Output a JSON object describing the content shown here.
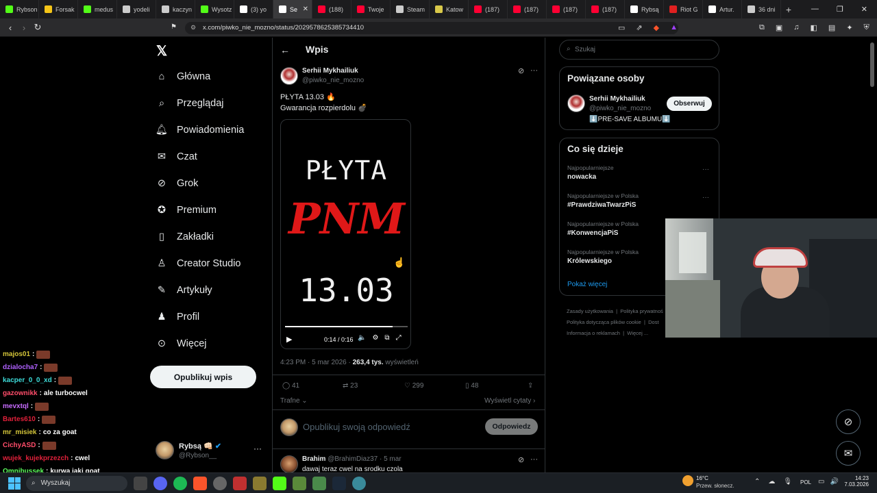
{
  "browser": {
    "tabs": [
      {
        "label": "Rybson",
        "icon": "kick-icon",
        "color": "#53fc18"
      },
      {
        "label": "Forsak",
        "icon": "forsak-icon",
        "color": "#f5c518"
      },
      {
        "label": "medus",
        "icon": "kick-icon",
        "color": "#53fc18"
      },
      {
        "label": "yodeli",
        "icon": "chrome-icon",
        "color": "#cccccc"
      },
      {
        "label": "kaczyn",
        "icon": "chrome-icon",
        "color": "#cccccc"
      },
      {
        "label": "Wysotz",
        "icon": "kick-icon",
        "color": "#53fc18"
      },
      {
        "label": "(3) yo",
        "icon": "x-icon",
        "color": "#ffffff"
      },
      {
        "label": "Se",
        "icon": "x-icon",
        "color": "#ffffff",
        "active": true
      },
      {
        "label": "(188)",
        "icon": "youtube-icon",
        "color": "#ff0033"
      },
      {
        "label": "Twoje",
        "icon": "youtube-icon",
        "color": "#ff0033"
      },
      {
        "label": "Steam",
        "icon": "steam-icon",
        "color": "#cccccc"
      },
      {
        "label": "Katow",
        "icon": "katow-icon",
        "color": "#d9c94a"
      },
      {
        "label": "(187)",
        "icon": "youtube-icon",
        "color": "#ff0033"
      },
      {
        "label": "(187)",
        "icon": "youtube-icon",
        "color": "#ff0033"
      },
      {
        "label": "(187)",
        "icon": "youtube-icon",
        "color": "#ff0033"
      },
      {
        "label": "(187)",
        "icon": "youtube-icon",
        "color": "#ff0033"
      },
      {
        "label": "Rybsą",
        "icon": "x-icon",
        "color": "#ffffff"
      },
      {
        "label": "Riot G",
        "icon": "riot-icon",
        "color": "#e02020"
      },
      {
        "label": "Artur.",
        "icon": "tiktok-icon",
        "color": "#ffffff"
      },
      {
        "label": "36 dni",
        "icon": "chrome-icon",
        "color": "#cccccc"
      }
    ],
    "url": "x.com/piwko_nie_mozno/status/2029578625385734410"
  },
  "nav": {
    "items": [
      {
        "label": "Główna",
        "icon": "home-icon"
      },
      {
        "label": "Przeglądaj",
        "icon": "search-icon"
      },
      {
        "label": "Powiadomienia",
        "icon": "bell-icon"
      },
      {
        "label": "Czat",
        "icon": "mail-icon"
      },
      {
        "label": "Grok",
        "icon": "grok-icon"
      },
      {
        "label": "Premium",
        "icon": "premium-icon"
      },
      {
        "label": "Zakładki",
        "icon": "bookmark-icon"
      },
      {
        "label": "Creator Studio",
        "icon": "creator-icon"
      },
      {
        "label": "Artykuły",
        "icon": "article-icon"
      },
      {
        "label": "Profil",
        "icon": "profile-icon"
      },
      {
        "label": "Więcej",
        "icon": "more-icon"
      }
    ],
    "post_button": "Opublikuj wpis",
    "user": {
      "name": "Rybsą 👊🏻",
      "handle": "@Rybson__"
    }
  },
  "main": {
    "header_title": "Wpis",
    "post": {
      "author": "Serhii Mykhailiuk",
      "handle": "@piwko_nie_mozno",
      "text_line1": "PŁYTA 13.03 🔥",
      "text_line2": "Gwarancja rozpierdolu 💣",
      "video": {
        "line1": "PŁYTA",
        "line2": "PNM",
        "line3": "13.03",
        "time": "0:14 / 0:16",
        "progress": 0.875
      },
      "timestamp": "4:23 PM · 5 mar 2026 · ",
      "views_count": "263,4 tys.",
      "views_label": " wyświetleń",
      "stats": {
        "replies": "41",
        "reposts": "23",
        "likes": "299",
        "bookmarks": "48"
      },
      "sort_label": "Trafne",
      "quotes_label": "Wyświetl cytaty"
    },
    "reply_box": {
      "placeholder": "Opublikuj swoją odpowiedź",
      "button": "Odpowiedz"
    },
    "first_reply": {
      "author": "Brahim",
      "handle": "@BrahimDiaz37",
      "time": "· 5 mar",
      "text": "dawaj teraz cwel na srodku czola"
    }
  },
  "sidebar": {
    "search_placeholder": "Szukaj",
    "related": {
      "title": "Powiązane osoby",
      "name": "Serhii Mykhailiuk",
      "handle": "@piwko_nie_mozno",
      "bio": "⬇️PRE-SAVE ALBUMU⬇️",
      "follow": "Obserwuj"
    },
    "trends": {
      "title": "Co się dzieje",
      "items": [
        {
          "context": "Najpopularniejsze",
          "name": "nowacka"
        },
        {
          "context": "Najpopularniejsze w Polska",
          "name": "#PrawdziwaTwarzPiS"
        },
        {
          "context": "Najpopularniejsze w Polska",
          "name": "#KonwencjaPiS"
        },
        {
          "context": "Najpopularniejsze w Polska",
          "name": "Królewskiego"
        }
      ],
      "show_more": "Pokaż więcej"
    },
    "footer": {
      "l1a": "Zasady użytkowania",
      "l1b": "Polityka prywatnoś",
      "l2a": "Polityka dotycząca plików cookie",
      "l2b": "Dost",
      "l3a": "Informacja o reklamach",
      "l3b": "Więcej ..."
    }
  },
  "chat": [
    {
      "user": "majos01",
      "color": "#d4c53a",
      "msg": ""
    },
    {
      "user": "dzialocha7",
      "color": "#b061ff",
      "msg": ""
    },
    {
      "user": "kacper_0_0_xd",
      "color": "#3ddbd9",
      "msg": ""
    },
    {
      "user": "gazownikk",
      "color": "#ff4d6a",
      "msg": "ale turbocwel"
    },
    {
      "user": "mevxtql",
      "color": "#c86cff",
      "msg": ""
    },
    {
      "user": "Bartes610",
      "color": "#e0203a",
      "msg": ""
    },
    {
      "user": "mr_misiek",
      "color": "#d4c53a",
      "msg": "co za goat"
    },
    {
      "user": "CichyASD",
      "color": "#ff4d6a",
      "msg": ""
    },
    {
      "user": "wujek_kujekprzezch",
      "color": "#e0203a",
      "msg": "cwel"
    },
    {
      "user": "Omnibussek",
      "color": "#5cff5c",
      "msg": "kurwa jaki goat"
    }
  ],
  "taskbar": {
    "search": "Wyszukaj",
    "weather_temp": "16°C",
    "weather_desc": "Przew. słonecz.",
    "lang": "POL",
    "time": "14:23",
    "date": "7.03.2026"
  }
}
